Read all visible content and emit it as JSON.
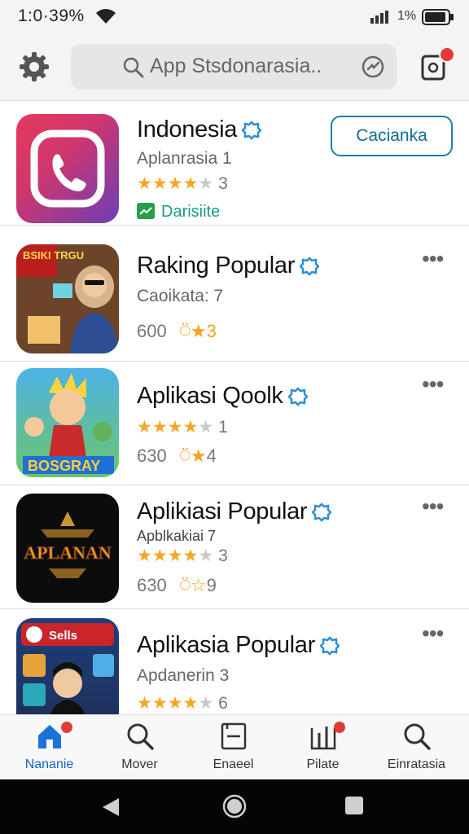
{
  "status_bar": {
    "time": "1:0·39%",
    "battery_pct": "1%"
  },
  "search": {
    "placeholder": "App Stsdonarasia.."
  },
  "apps": [
    {
      "title": "Indonesia",
      "subtitle": "Aplanrasia 1",
      "stars": 4,
      "rating_count": "3",
      "action_label": "Cacianka",
      "tag_label": "Darisiite"
    },
    {
      "title": "Raking Popular",
      "subtitle": "Caoikata: 7",
      "meta_count": "600",
      "badge_count": "3",
      "thumb_text": "BSIKI TRGU"
    },
    {
      "title": "Aplikasi Qoolk",
      "stars": 4,
      "rating_count": "1",
      "meta_count": "630",
      "badge_count": "4",
      "thumb_text": "BOSGRAY"
    },
    {
      "title": "Aplikiasi Popular",
      "subtitle": "Apblkakiai 7",
      "stars": 4,
      "rating_count": "3",
      "meta_count": "630",
      "badge_count": "9",
      "thumb_text": "APLANAN"
    },
    {
      "title": "Aplikasia Popular",
      "subtitle": "Apdanerin 3",
      "stars": 4,
      "rating_count": "6",
      "thumb_text": "Sells"
    }
  ],
  "bottom_nav": [
    {
      "label": "Nananie",
      "icon": "home-icon",
      "active": true
    },
    {
      "label": "Mover",
      "icon": "search-icon"
    },
    {
      "label": "Enaeel",
      "icon": "document-icon"
    },
    {
      "label": "Pilate",
      "icon": "chart-icon"
    },
    {
      "label": "Einratasia",
      "icon": "search-icon"
    }
  ],
  "colors": {
    "accent": "#1565c0",
    "star": "#f5a623",
    "notification": "#e53935",
    "verified": "#2a8fd6"
  }
}
